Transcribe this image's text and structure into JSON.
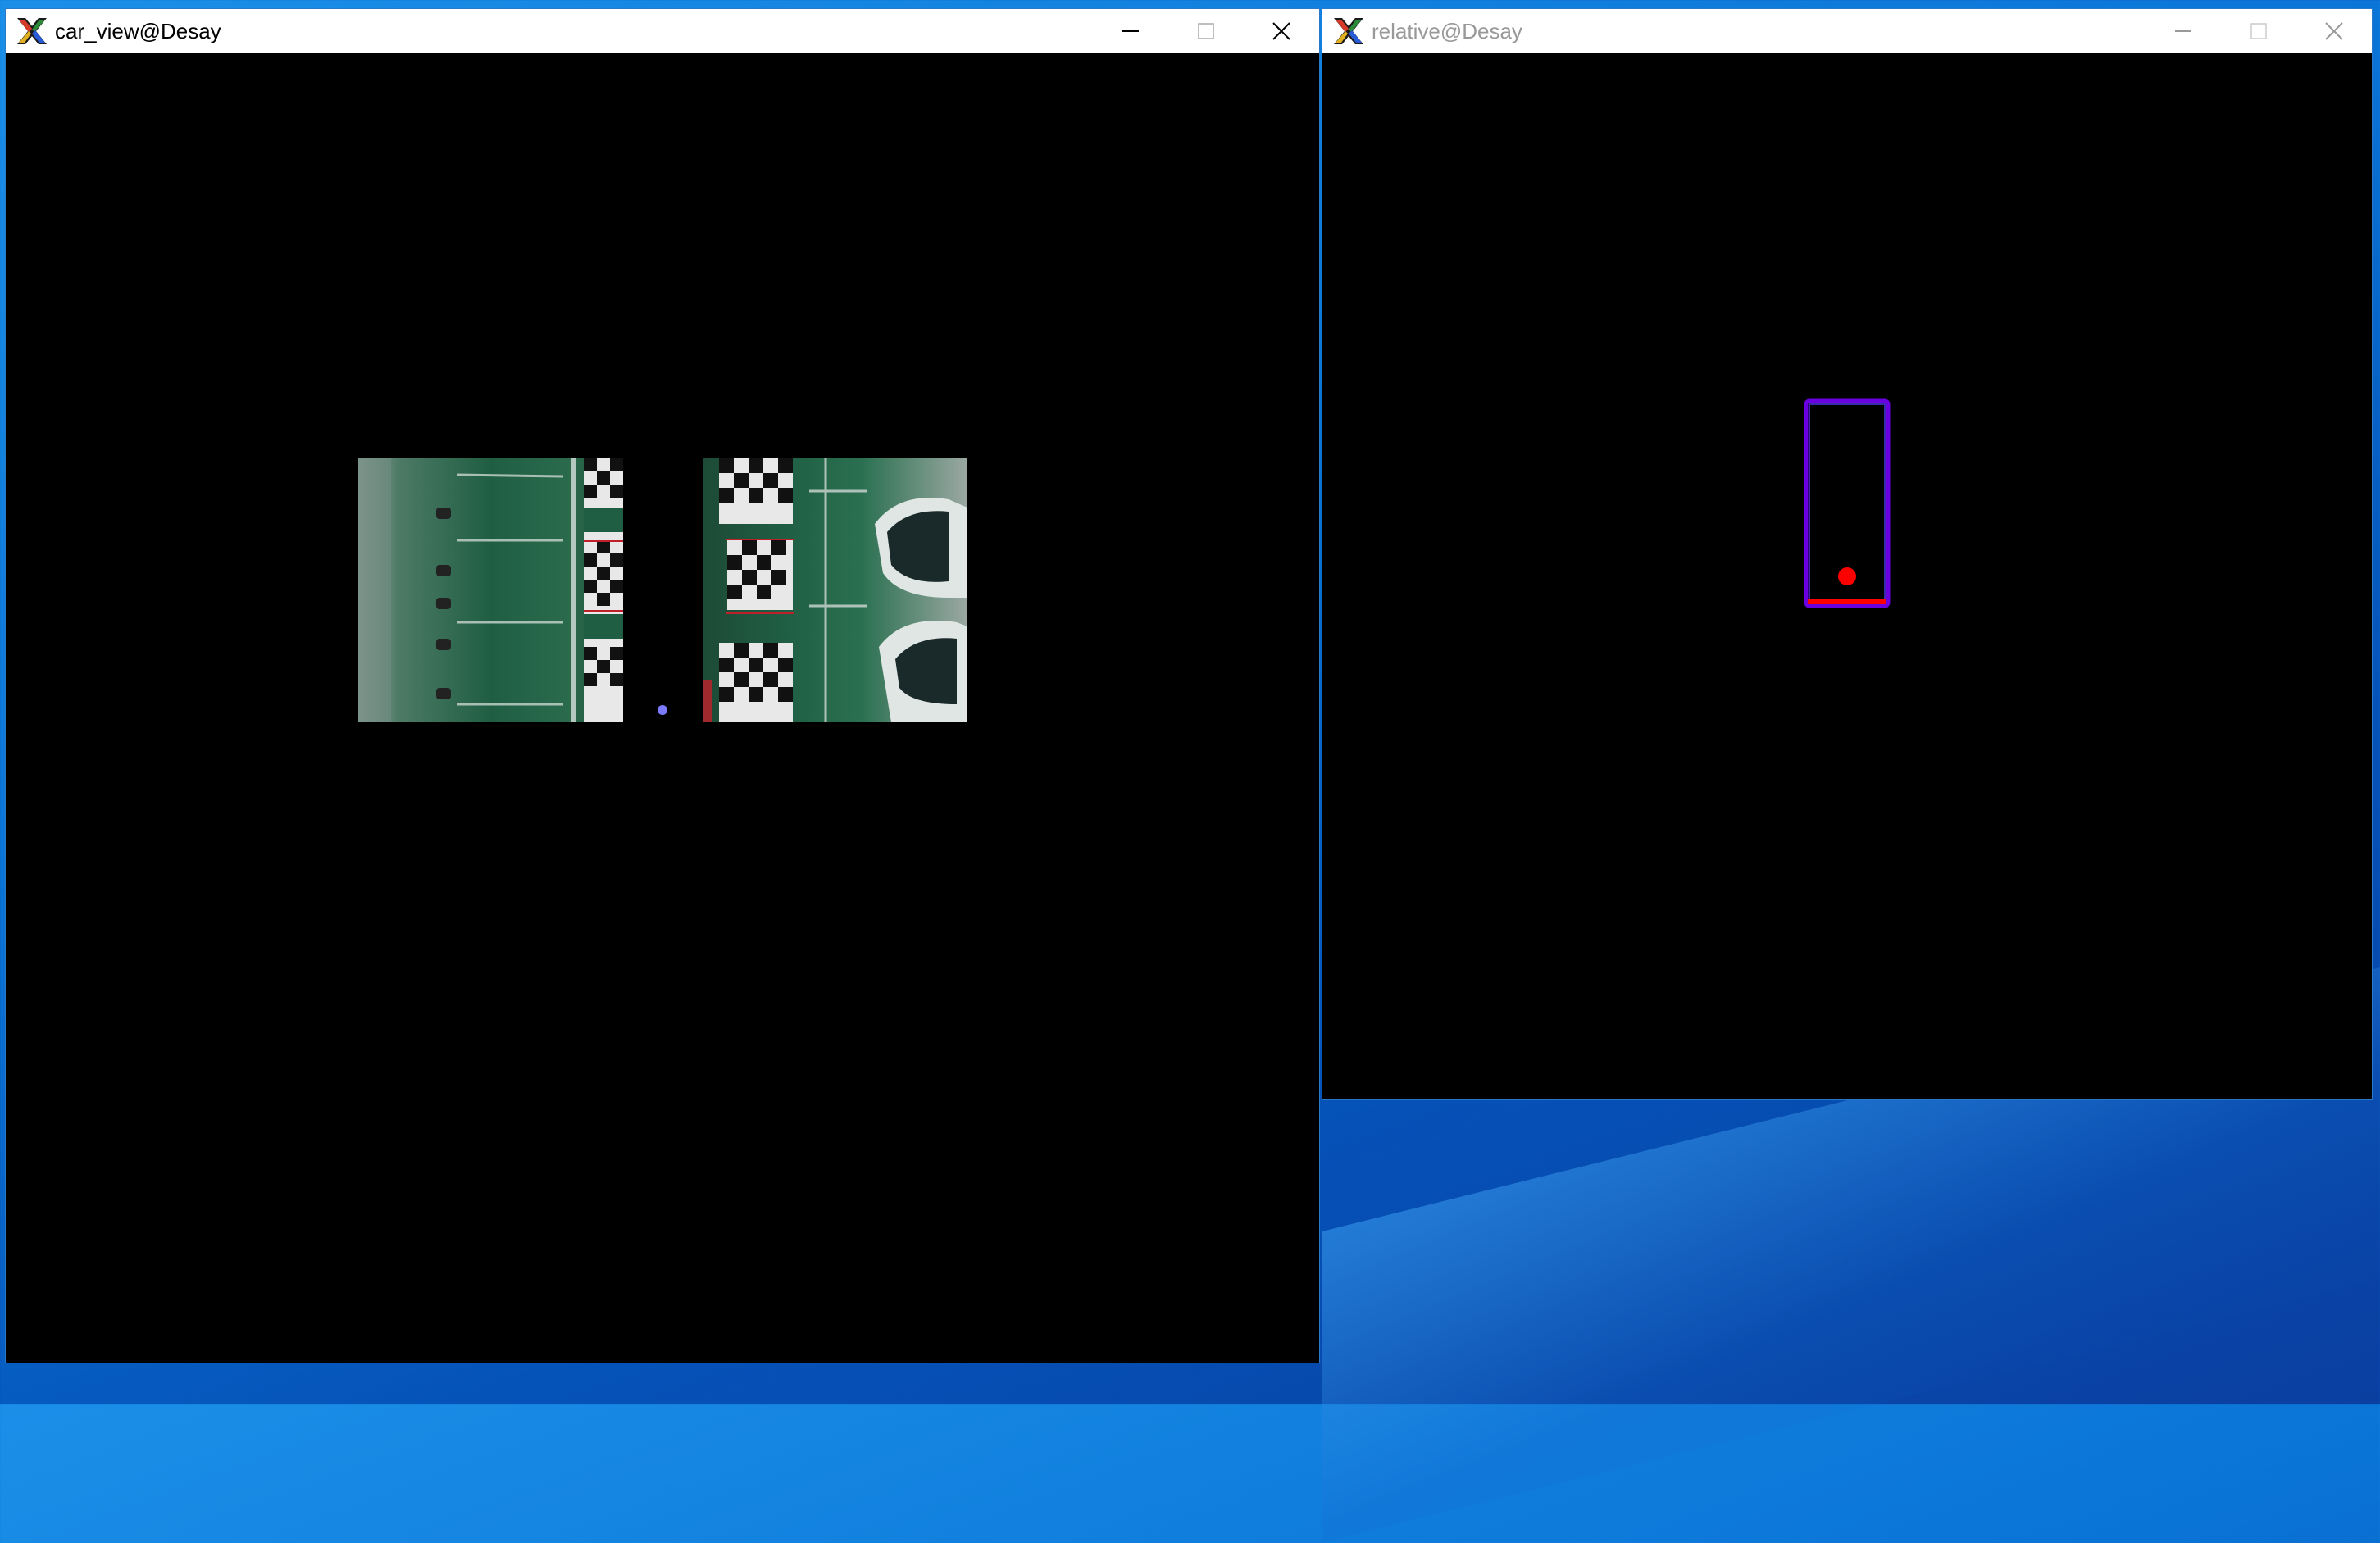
{
  "windows": {
    "car_view": {
      "title": "car_view@Desay",
      "state": "active"
    },
    "relative": {
      "title": "relative@Desay",
      "state": "inactive"
    }
  },
  "controls": {
    "minimize_icon": "minimize-icon",
    "maximize_icon": "maximize-icon",
    "close_icon": "close-icon"
  },
  "colors": {
    "desktop_blue": "#0a74d6",
    "marker_dot": "#7b7bff",
    "vehicle_outline": "#6a00e0",
    "vehicle_front": "#ff0000",
    "position_dot": "#ff0000",
    "camera_green": "#1f5e43"
  }
}
